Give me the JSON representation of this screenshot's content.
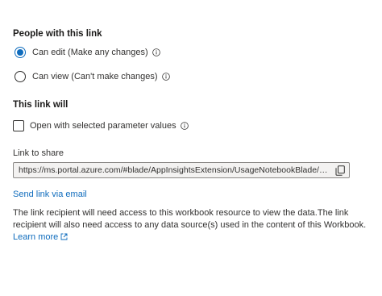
{
  "sections": {
    "people_title": "People with this link",
    "this_link_title": "This link will"
  },
  "permissions": {
    "can_edit_label": "Can edit (Make any changes)",
    "can_view_label": "Can view (Can't make changes)",
    "selected": "can_edit"
  },
  "options": {
    "parameter_values_label": "Open with selected parameter values",
    "parameter_values_checked": false
  },
  "share": {
    "link_label": "Link to share",
    "link_value": "https://ms.portal.azure.com/#blade/AppInsightsExtension/UsageNotebookBlade/Com...",
    "send_email_label": "Send link via email"
  },
  "note": {
    "text": "The link recipient will need access to this workbook resource to view the data.The link recipient will also need access to any data source(s) used in the content of this Workbook.",
    "learn_more": "Learn more"
  },
  "colors": {
    "accent": "#0f6cbd",
    "text": "#323130",
    "field_bg": "#f3f2f1"
  },
  "icons": [
    "info-icon",
    "copy-icon",
    "external-link-icon"
  ]
}
